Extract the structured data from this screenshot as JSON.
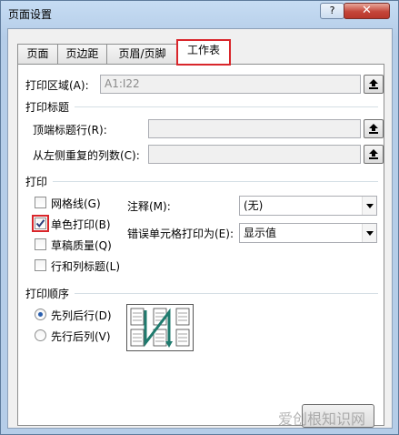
{
  "window": {
    "title": "页面设置",
    "help_label": "?",
    "close_label": "✕"
  },
  "tabs": [
    {
      "label": "页面",
      "active": false
    },
    {
      "label": "页边距",
      "active": false
    },
    {
      "label": "页眉/页脚",
      "active": false
    },
    {
      "label": "工作表",
      "active": true
    }
  ],
  "print_area": {
    "label": "打印区域(A):",
    "value": "A1:I22"
  },
  "print_titles": {
    "group_label": "打印标题",
    "rows_label": "顶端标题行(R):",
    "rows_value": "",
    "cols_label": "从左侧重复的列数(C):",
    "cols_value": ""
  },
  "print": {
    "group_label": "打印",
    "gridlines": {
      "label": "网格线(G)",
      "checked": false
    },
    "black_white": {
      "label": "单色打印(B)",
      "checked": true
    },
    "draft": {
      "label": "草稿质量(Q)",
      "checked": false
    },
    "headings": {
      "label": "行和列标题(L)",
      "checked": false
    },
    "comments_label": "注释(M):",
    "comments_value": "(无)",
    "errors_label": "错误单元格打印为(E):",
    "errors_value": "显示值"
  },
  "page_order": {
    "group_label": "打印顺序",
    "down_then_over": {
      "label": "先列后行(D)",
      "selected": true
    },
    "over_then_down": {
      "label": "先行后列(V)",
      "selected": false
    }
  },
  "watermark": "爱创根知识网"
}
